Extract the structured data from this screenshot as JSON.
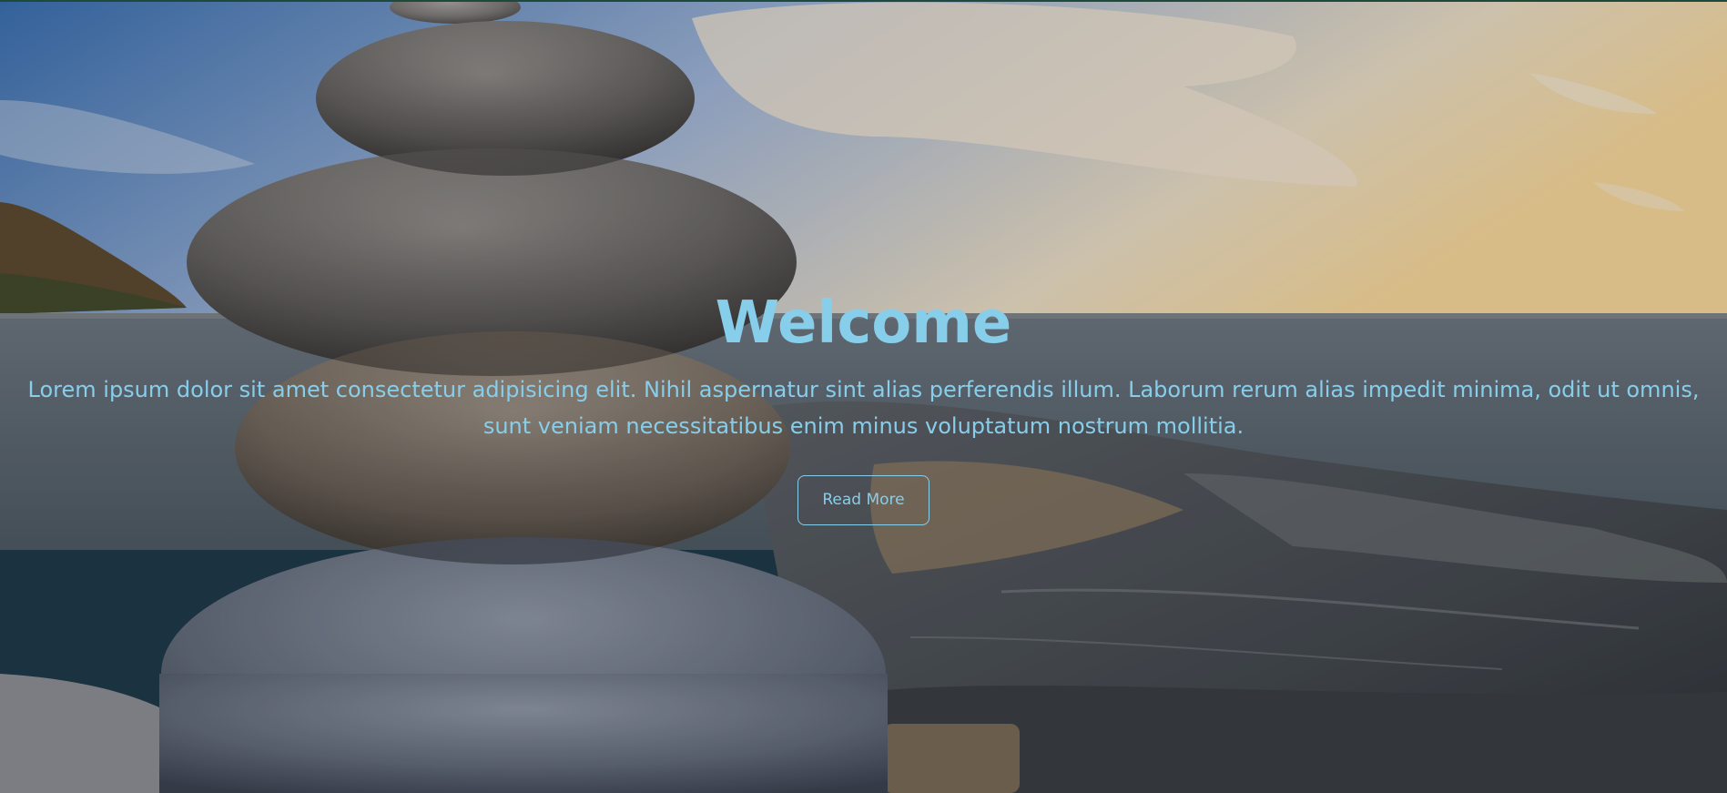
{
  "hero": {
    "title": "Welcome",
    "text": "Lorem ipsum dolor sit amet consectetur adipisicing elit. Nihil aspernatur sint alias perferendis illum. Laborum rerum alias impedit minima, odit ut omnis, sunt veniam necessitatibus enim minus voluptatum nostrum mollitia.",
    "button_label": "Read More"
  },
  "colors": {
    "text_accent": "#87ceeb"
  }
}
